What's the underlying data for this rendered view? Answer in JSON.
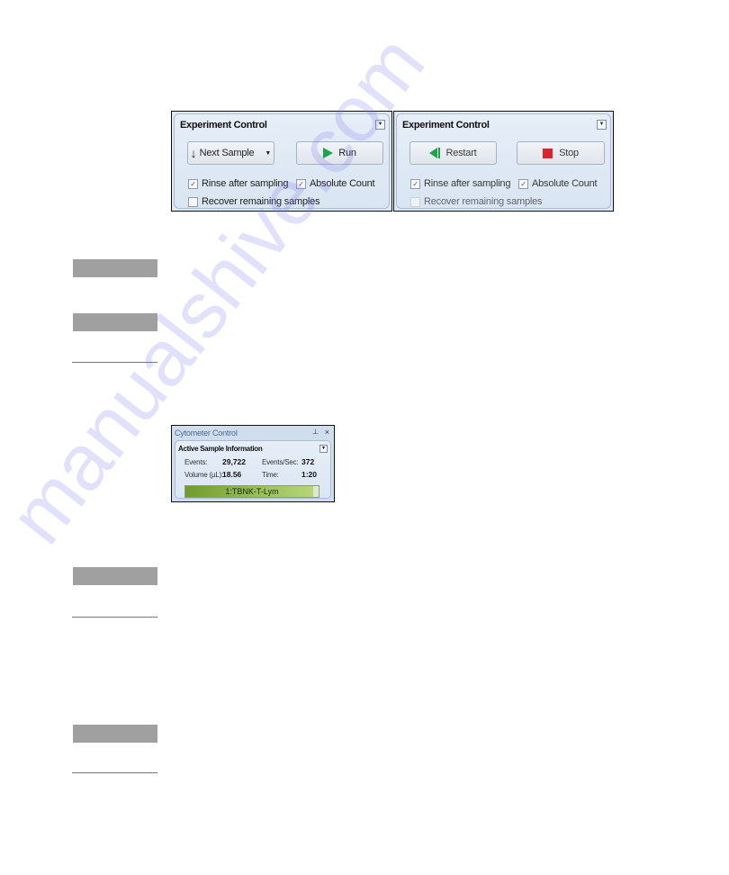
{
  "experiment_control_idle": {
    "title": "Experiment Control",
    "collapse_icon": "chevron-down-icon",
    "buttons": [
      {
        "label": "Next Sample",
        "icon": "down-arrow-icon",
        "has_dropdown": true
      },
      {
        "label": "Run",
        "icon": "play-icon",
        "icon_color": "#1fa24a"
      }
    ],
    "checkboxes": [
      {
        "label": "Rinse after sampling",
        "checked": true
      },
      {
        "label": "Absolute Count",
        "checked": true
      },
      {
        "label": "Recover remaining samples",
        "checked": false
      }
    ]
  },
  "experiment_control_running": {
    "title": "Experiment Control",
    "collapse_icon": "chevron-down-icon",
    "buttons": [
      {
        "label": "Restart",
        "icon": "restart-icon",
        "icon_color": "#1fa24a"
      },
      {
        "label": "Stop",
        "icon": "stop-icon",
        "icon_color": "#e0202a"
      }
    ],
    "checkboxes": [
      {
        "label": "Rinse after sampling",
        "checked": true
      },
      {
        "label": "Absolute Count",
        "checked": true
      },
      {
        "label": "Recover remaining samples",
        "checked": false
      }
    ]
  },
  "cytometer_control": {
    "title": "Cytometer Control",
    "section_title": "Active Sample Information",
    "fields": {
      "events_label": "Events:",
      "events_value": "29,722",
      "events_per_sec_label": "Events/Sec:",
      "events_per_sec_value": "372",
      "volume_label": "Volume (µL):",
      "volume_value": "18.56",
      "time_label": "Time:",
      "time_value": "1:20"
    },
    "progress": {
      "label": "1:TBNK-T-Lym",
      "fraction": 0.96
    }
  },
  "watermark": "manualshive.com",
  "checkmark": "✓"
}
